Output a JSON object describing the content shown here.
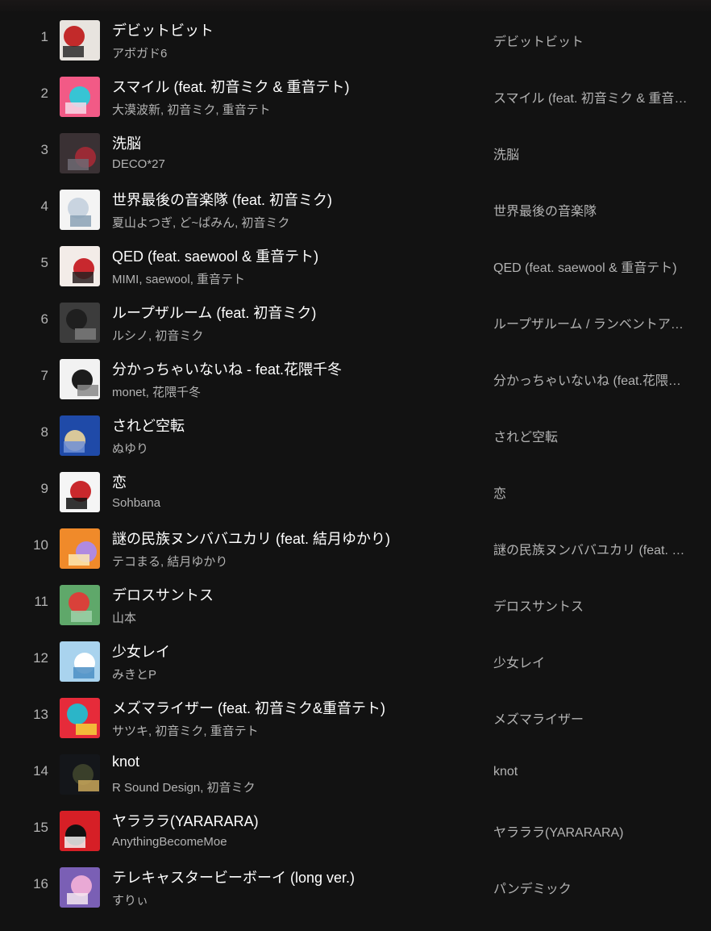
{
  "tracks": [
    {
      "num": "1",
      "title": "デビットビット",
      "artists": "アボガド6",
      "album": "デビットビット",
      "art_colors": [
        "#e8e4df",
        "#c22a2a",
        "#2b2b2b"
      ]
    },
    {
      "num": "2",
      "title": "スマイル (feat. 初音ミク & 重音テト)",
      "artists": "大漠波新, 初音ミク, 重音テト",
      "album": "スマイル (feat. 初音ミク & 重音テト)",
      "art_colors": [
        "#f25a86",
        "#37c4d4",
        "#f7d9e8"
      ]
    },
    {
      "num": "3",
      "title": "洗脳",
      "artists": "DECO*27",
      "album": "洗脳",
      "art_colors": [
        "#3a3134",
        "#9a2a35",
        "#6e6a73"
      ]
    },
    {
      "num": "4",
      "title": "世界最後の音楽隊 (feat. 初音ミク)",
      "artists": "夏山よつぎ, ど~ぱみん, 初音ミク",
      "album": "世界最後の音楽隊",
      "art_colors": [
        "#f4f4f4",
        "#c9d4e0",
        "#8aa1b5"
      ]
    },
    {
      "num": "5",
      "title": "QED (feat. saewool & 重音テト)",
      "artists": "MIMI, saewool, 重音テト",
      "album": "QED (feat. saewool & 重音テト)",
      "art_colors": [
        "#f3ece8",
        "#c8282e",
        "#2a2020"
      ]
    },
    {
      "num": "6",
      "title": "ループザルーム (feat. 初音ミク)",
      "artists": "ルシノ, 初音ミク",
      "album": "ループザルーム / ランベントア…",
      "art_colors": [
        "#3c3c3c",
        "#1f1f1f",
        "#7a7a7a"
      ]
    },
    {
      "num": "7",
      "title": "分かっちゃいないね - feat.花隈千冬",
      "artists": "monet, 花隈千冬",
      "album": "分かっちゃいないね (feat.花隈…",
      "art_colors": [
        "#f2f2f2",
        "#1c1c1c",
        "#8a8a8a"
      ]
    },
    {
      "num": "8",
      "title": "されど空転",
      "artists": "ぬゆり",
      "album": "されど空転",
      "art_colors": [
        "#1f4aa8",
        "#d9c89a",
        "#6f8fd6"
      ]
    },
    {
      "num": "9",
      "title": "恋",
      "artists": "Sohbana",
      "album": "恋",
      "art_colors": [
        "#f5f5f5",
        "#c9282c",
        "#111111"
      ]
    },
    {
      "num": "10",
      "title": "謎の民族ヌンババユカリ (feat. 結月ゆかり)",
      "artists": "テコまる, 結月ゆかり",
      "album": "謎の民族ヌンババユカリ (feat. …",
      "art_colors": [
        "#f08a2a",
        "#b08ae0",
        "#fde7b0"
      ]
    },
    {
      "num": "11",
      "title": "デロスサントス",
      "artists": "山本",
      "album": "デロスサントス",
      "art_colors": [
        "#5fa86a",
        "#d9413a",
        "#9ed1a8"
      ]
    },
    {
      "num": "12",
      "title": "少女レイ",
      "artists": "みきとP",
      "album": "少女レイ",
      "art_colors": [
        "#a9d3ee",
        "#ffffff",
        "#4b8ec4"
      ]
    },
    {
      "num": "13",
      "title": "メズマライザー (feat. 初音ミク&重音テト)",
      "artists": "サツキ, 初音ミク, 重音テト",
      "album": "メズマライザー",
      "art_colors": [
        "#e62b3a",
        "#2bb5c8",
        "#f4d23a"
      ]
    },
    {
      "num": "14",
      "title": "knot",
      "artists": "R Sound Design, 初音ミク",
      "album": "knot",
      "art_colors": [
        "#14161a",
        "#3a3f2a",
        "#c9a75a"
      ]
    },
    {
      "num": "15",
      "title": "ヤラララ(YARARARA)",
      "artists": "AnythingBecomeMoe",
      "album": "ヤラララ(YARARARA)",
      "art_colors": [
        "#d61f26",
        "#111111",
        "#f2f2f2"
      ]
    },
    {
      "num": "16",
      "title": "テレキャスタービーボーイ (long ver.)",
      "artists": "すりぃ",
      "album": "パンデミック",
      "art_colors": [
        "#7a5fb5",
        "#e9a9d5",
        "#f5e6f0"
      ]
    }
  ]
}
